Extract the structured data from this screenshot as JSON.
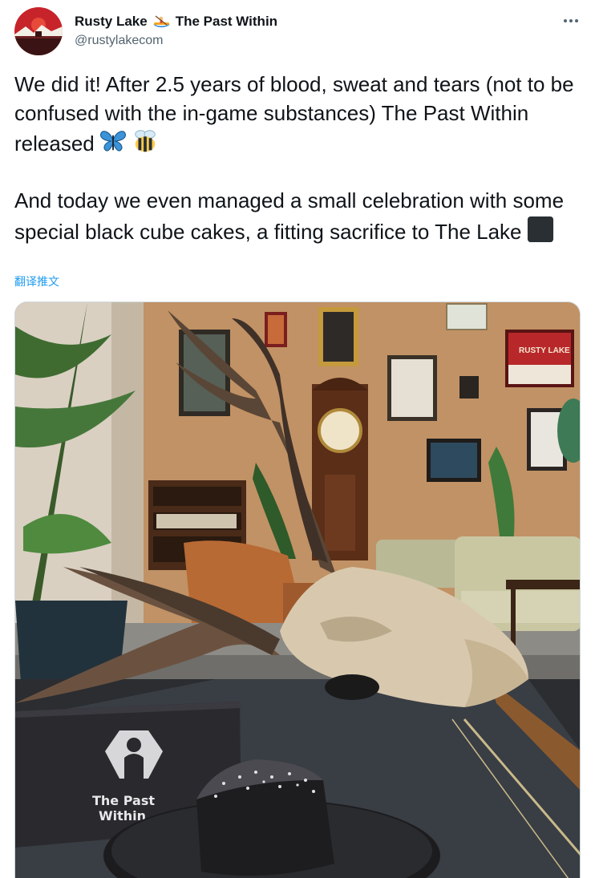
{
  "tweet": {
    "author": {
      "display_name": "Rusty Lake",
      "display_name_suffix": "The Past Within",
      "handle": "@rustylakecom",
      "avatar_icon": "rusty-lake-logo",
      "name_emoji": "kayak-icon"
    },
    "more_icon": "ellipsis-icon",
    "text": {
      "paragraph_1": "We did it! After 2.5 years of blood, sweat and tears (not to be confused with the in-game substances) The Past Within released",
      "paragraph_1_emojis": [
        "butterfly-icon",
        "bee-icon"
      ],
      "paragraph_2": "And today we even managed a small celebration with some special black cube cakes, a fitting sacrifice to The Lake",
      "paragraph_2_emojis": [
        "black-square-icon"
      ]
    },
    "translate_label": "翻译推文",
    "photo": {
      "box_text_line_1": "The Past",
      "box_text_line_2": "Within",
      "poster_text": "RUSTY LAKE"
    },
    "colors": {
      "link": "#1d9bf0",
      "secondary_text": "#536471",
      "primary_text": "#0f1419"
    }
  }
}
